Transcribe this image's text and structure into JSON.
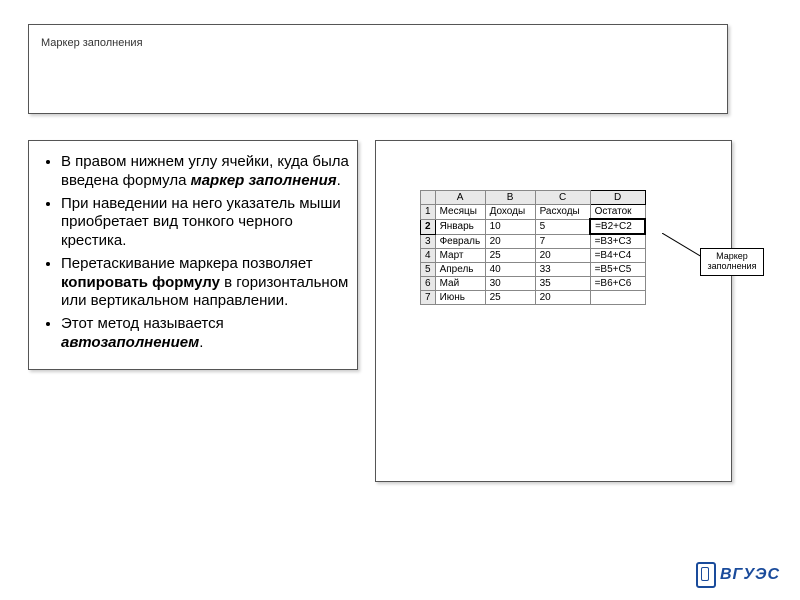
{
  "title": "Маркер заполнения",
  "bullets": [
    {
      "pre": "В правом нижнем углу ячейки, куда была введена формула ",
      "em": "маркер заполнения",
      "post": "."
    },
    {
      "pre": "При наведении на него указатель мыши приобретает вид тонкого черного крестика.",
      "em": "",
      "post": ""
    },
    {
      "pre": "Перетаскивание маркера позволяет ",
      "em": "копировать формулу",
      "post": " в горизонтальном или вертикальном направлении."
    },
    {
      "pre": "Этот метод называется ",
      "em": "автозаполнением",
      "post": "."
    }
  ],
  "sheet": {
    "cols": [
      "A",
      "B",
      "C",
      "D"
    ],
    "headers_row": {
      "A": "Месяцы",
      "B": "Доходы",
      "C": "Расходы",
      "D": "Остаток"
    },
    "rows": [
      {
        "n": "1",
        "A": "Месяцы",
        "B": "Доходы",
        "C": "Расходы",
        "D": "Остаток"
      },
      {
        "n": "2",
        "A": "Январь",
        "B": "10",
        "C": "5",
        "D": "=B2+C2"
      },
      {
        "n": "3",
        "A": "Февраль",
        "B": "20",
        "C": "7",
        "D": "=B3+C3"
      },
      {
        "n": "4",
        "A": "Март",
        "B": "25",
        "C": "20",
        "D": "=B4+C4"
      },
      {
        "n": "5",
        "A": "Апрель",
        "B": "40",
        "C": "33",
        "D": "=B5+C5"
      },
      {
        "n": "6",
        "A": "Май",
        "B": "30",
        "C": "35",
        "D": "=B6+C6"
      },
      {
        "n": "7",
        "A": "Июнь",
        "B": "25",
        "C": "20",
        "D": ""
      }
    ],
    "selected_cell": "D2",
    "selected_col": "D"
  },
  "callout": {
    "line1": "Маркер",
    "line2": "заполнения"
  },
  "logo_text": "ВГУЭС"
}
